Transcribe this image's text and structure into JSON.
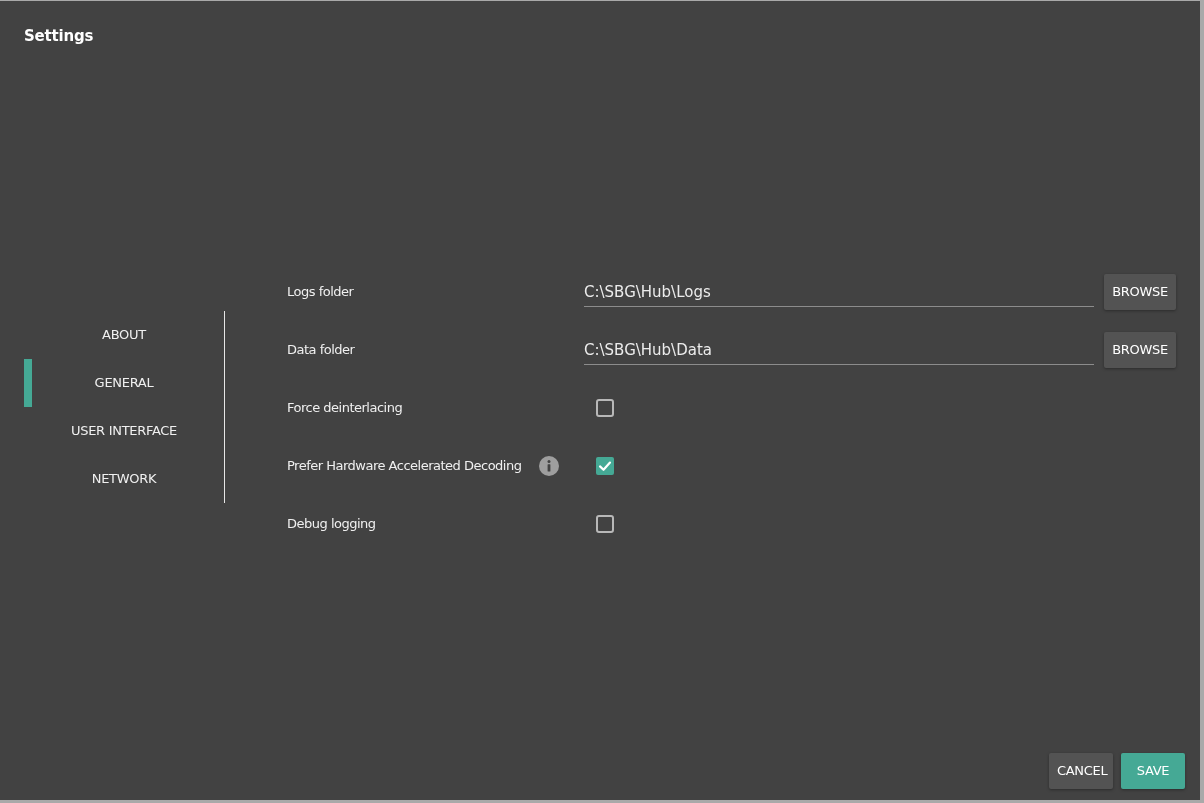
{
  "dialog": {
    "title": "Settings"
  },
  "sidebar": {
    "items": [
      {
        "label": "ABOUT",
        "selected": false
      },
      {
        "label": "GENERAL",
        "selected": true
      },
      {
        "label": "USER INTERFACE",
        "selected": false
      },
      {
        "label": "NETWORK",
        "selected": false
      }
    ]
  },
  "settings": [
    {
      "kind": "folder",
      "label": "Logs folder",
      "value": "C:\\SBG\\Hub\\Logs",
      "button": "BROWSE",
      "info": false
    },
    {
      "kind": "folder",
      "label": "Data folder",
      "value": "C:\\SBG\\Hub\\Data",
      "button": "BROWSE",
      "info": false
    },
    {
      "kind": "checkbox",
      "label": "Force deinterlacing",
      "checked": false,
      "info": false
    },
    {
      "kind": "checkbox",
      "label": "Prefer Hardware Accelerated Decoding",
      "checked": true,
      "info": true
    },
    {
      "kind": "checkbox",
      "label": "Debug logging",
      "checked": false,
      "info": false
    }
  ],
  "buttons": [
    {
      "label": "CANCEL",
      "kind": "secondary"
    },
    {
      "label": "SAVE",
      "kind": "primary"
    }
  ]
}
